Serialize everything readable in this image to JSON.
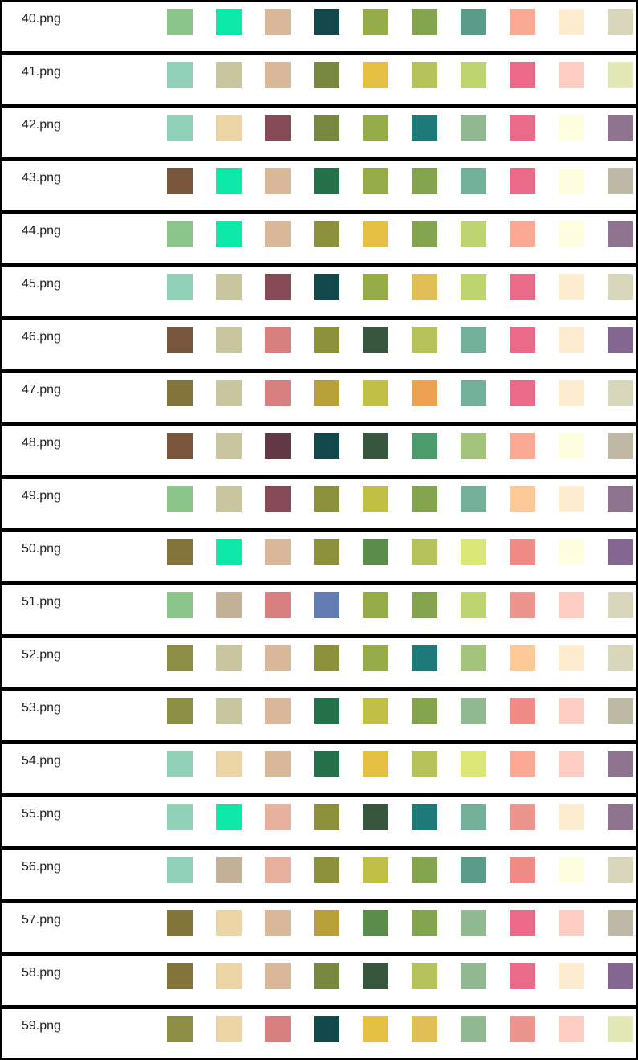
{
  "rows": [
    {
      "label": "40.png",
      "colors": [
        "#8cc589",
        "#0be8a8",
        "#d9b89a",
        "#13484b",
        "#96ad47",
        "#84a34d",
        "#5a9c8a",
        "#fba994",
        "#feecd0",
        "#d9d7bb"
      ]
    },
    {
      "label": "41.png",
      "colors": [
        "#90d1b8",
        "#c9c59f",
        "#d9b89a",
        "#78873e",
        "#e4c142",
        "#b6c35b",
        "#bcd56f",
        "#e96b89",
        "#fecdc4",
        "#e3e8b7"
      ]
    },
    {
      "label": "42.png",
      "colors": [
        "#90d1b8",
        "#ecd6a5",
        "#874b58",
        "#78873e",
        "#96ad47",
        "#1e7a79",
        "#91b991",
        "#e96b89",
        "#fdffe0",
        "#8f7490"
      ]
    },
    {
      "label": "43.png",
      "colors": [
        "#78563c",
        "#0be8a8",
        "#d9b89a",
        "#25724a",
        "#96ad47",
        "#84a34d",
        "#72b09a",
        "#e96b89",
        "#fdffe0",
        "#beb8a5"
      ]
    },
    {
      "label": "44.png",
      "colors": [
        "#8cc589",
        "#0be8a8",
        "#d9b89a",
        "#8c903a",
        "#e4c142",
        "#84a34d",
        "#bcd56f",
        "#fba994",
        "#fdffe0",
        "#8f7490"
      ]
    },
    {
      "label": "45.png",
      "colors": [
        "#90d1b8",
        "#c9c59f",
        "#874b58",
        "#13484b",
        "#96ad47",
        "#e0c056",
        "#bcd56f",
        "#e96b89",
        "#feecd0",
        "#d9d7bb"
      ]
    },
    {
      "label": "46.png",
      "colors": [
        "#78563c",
        "#c9c59f",
        "#d88080",
        "#8c903a",
        "#38563e",
        "#b6c35b",
        "#72b09a",
        "#e96b89",
        "#feecd0",
        "#836791"
      ]
    },
    {
      "label": "47.png",
      "colors": [
        "#837439",
        "#c9c59f",
        "#d88080",
        "#b8a039",
        "#c0c045",
        "#eba352",
        "#72b09a",
        "#e96b89",
        "#feecd0",
        "#d9d7bb"
      ]
    },
    {
      "label": "48.png",
      "colors": [
        "#78563c",
        "#c9c59f",
        "#623845",
        "#13484b",
        "#38563e",
        "#4b9c6a",
        "#a3c27a",
        "#fba994",
        "#fdffe0",
        "#beb8a5"
      ]
    },
    {
      "label": "49.png",
      "colors": [
        "#8cc589",
        "#c9c59f",
        "#874b58",
        "#8c903a",
        "#c0c045",
        "#84a34d",
        "#72b09a",
        "#fdc998",
        "#feecd0",
        "#8f7490"
      ]
    },
    {
      "label": "50.png",
      "colors": [
        "#837439",
        "#0be8a8",
        "#d9b89a",
        "#8c903a",
        "#5a8c4b",
        "#b6c35b",
        "#dbe877",
        "#f08a86",
        "#fdffe0",
        "#836791"
      ]
    },
    {
      "label": "51.png",
      "colors": [
        "#8cc589",
        "#c2b097",
        "#d88080",
        "#627bb3",
        "#96ad47",
        "#84a34d",
        "#bcd56f",
        "#ec958f",
        "#fecdc4",
        "#d9d7bb"
      ]
    },
    {
      "label": "52.png",
      "colors": [
        "#8c8f45",
        "#c9c59f",
        "#d9b89a",
        "#8c903a",
        "#96ad47",
        "#1e7a79",
        "#a3c27a",
        "#fdc998",
        "#feecd0",
        "#d9d7bb"
      ]
    },
    {
      "label": "53.png",
      "colors": [
        "#8c8f45",
        "#c9c59f",
        "#d9b89a",
        "#25724a",
        "#c0c045",
        "#84a34d",
        "#91b991",
        "#f08a86",
        "#fecdc4",
        "#beb8a5"
      ]
    },
    {
      "label": "54.png",
      "colors": [
        "#90d1b8",
        "#ecd6a5",
        "#d9b89a",
        "#25724a",
        "#e4c142",
        "#b6c35b",
        "#dbe877",
        "#fba994",
        "#fecdc4",
        "#8f7490"
      ]
    },
    {
      "label": "55.png",
      "colors": [
        "#90d1b8",
        "#0be8a8",
        "#e8b09e",
        "#8c903a",
        "#38563e",
        "#1e7a79",
        "#72b09a",
        "#ec958f",
        "#feecd0",
        "#8f7490"
      ]
    },
    {
      "label": "56.png",
      "colors": [
        "#90d1b8",
        "#c2b097",
        "#e8b09e",
        "#8c903a",
        "#c0c045",
        "#84a34d",
        "#5a9c8a",
        "#f08a86",
        "#fdffe0",
        "#d9d7bb"
      ]
    },
    {
      "label": "57.png",
      "colors": [
        "#837439",
        "#ecd6a5",
        "#d9b89a",
        "#b8a039",
        "#5a8c4b",
        "#84a34d",
        "#91b991",
        "#e96b89",
        "#fecdc4",
        "#beb8a5"
      ]
    },
    {
      "label": "58.png",
      "colors": [
        "#837439",
        "#ecd6a5",
        "#d9b89a",
        "#78873e",
        "#38563e",
        "#b6c35b",
        "#91b991",
        "#e96b89",
        "#feecd0",
        "#836791"
      ]
    },
    {
      "label": "59.png",
      "colors": [
        "#8c8f45",
        "#ecd6a5",
        "#d88080",
        "#13484b",
        "#e4c142",
        "#e0c056",
        "#91b991",
        "#ec958f",
        "#fecdc4",
        "#e3e8b7"
      ]
    }
  ]
}
